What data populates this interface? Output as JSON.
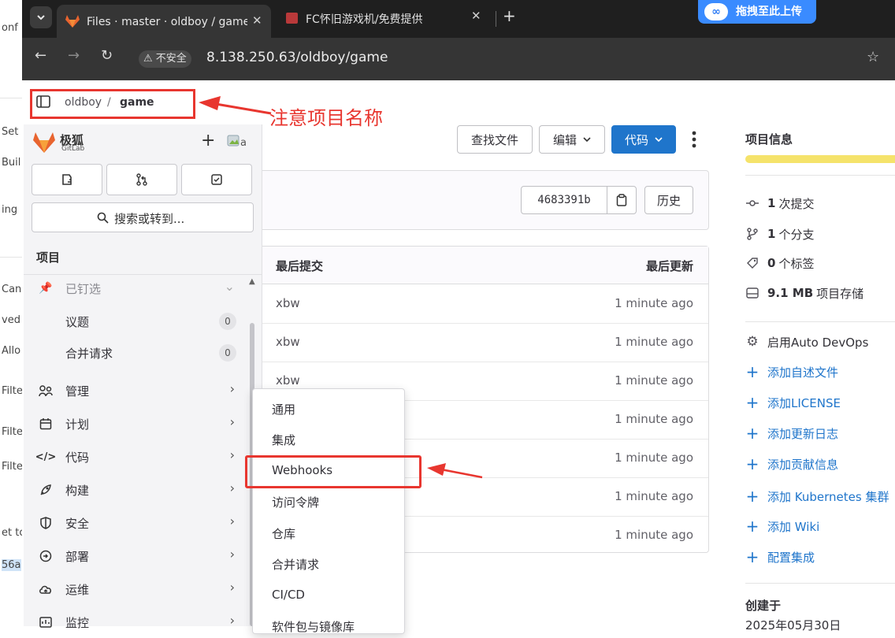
{
  "background_window": {
    "lines": [
      "onf",
      "Set",
      "Buil",
      "ing",
      "Can",
      "ved",
      "Allo",
      "Filte",
      "Filte",
      "Filte",
      "et to",
      "56a"
    ]
  },
  "browser": {
    "tabs": [
      {
        "title": "Files · master · oldboy / game",
        "active": true
      },
      {
        "title": "FC怀旧游戏机/免费提供",
        "active": false
      }
    ],
    "upload_badge": {
      "icon": "∞",
      "label": "拖拽至此上传"
    },
    "security_label": "不安全",
    "url": "8.138.250.63/oldboy/game"
  },
  "breadcrumb": {
    "owner": "oldboy",
    "project": "game"
  },
  "annotation": {
    "text": "注意项目名称"
  },
  "sidebar": {
    "brand_name": "极狐",
    "brand_sub": "GitLab",
    "search_label": "搜索或转到...",
    "section_title": "项目",
    "items": [
      {
        "label": "已钉选",
        "icon": "pin-icon",
        "muted": true
      },
      {
        "label": "议题",
        "badge": "0"
      },
      {
        "label": "合并请求",
        "badge": "0"
      },
      {
        "label": "管理",
        "icon": "people-icon"
      },
      {
        "label": "计划",
        "icon": "calendar-icon"
      },
      {
        "label": "代码",
        "icon": "code-icon"
      },
      {
        "label": "构建",
        "icon": "rocket-icon"
      },
      {
        "label": "安全",
        "icon": "shield-icon"
      },
      {
        "label": "部署",
        "icon": "deploy-icon"
      },
      {
        "label": "运维",
        "icon": "cloud-icon"
      },
      {
        "label": "监控",
        "icon": "monitor-icon"
      }
    ]
  },
  "flyout": {
    "items": [
      "通用",
      "集成",
      "Webhooks",
      "访问令牌",
      "仓库",
      "合并请求",
      "CI/CD",
      "软件包与镜像库"
    ]
  },
  "toolbar": {
    "find_file": "查找文件",
    "edit": "编辑",
    "code": "代码"
  },
  "commit": {
    "sha": "4683391b",
    "history": "历史"
  },
  "file_table": {
    "columns": [
      "最后提交",
      "最后更新"
    ],
    "rows": [
      {
        "name": "xbw",
        "time": "1 minute ago"
      },
      {
        "name": "xbw",
        "time": "1 minute ago"
      },
      {
        "name": "xbw",
        "time": "1 minute ago"
      },
      {
        "name": "",
        "time": "1 minute ago"
      },
      {
        "name": "",
        "time": "1 minute ago"
      },
      {
        "name": "",
        "time": "1 minute ago"
      },
      {
        "name": "",
        "time": "1 minute ago"
      }
    ]
  },
  "project_info": {
    "title": "项目信息",
    "stats": [
      {
        "value": "1",
        "label": "次提交",
        "icon": "commit-icon"
      },
      {
        "value": "1",
        "label": "个分支",
        "icon": "branch-icon"
      },
      {
        "value": "0",
        "label": "个标签",
        "icon": "tag-icon"
      },
      {
        "value": "9.1 MB",
        "label": "项目存储",
        "icon": "storage-icon"
      }
    ],
    "auto_devops": "启用Auto DevOps",
    "actions": [
      "添加自述文件",
      "添加LICENSE",
      "添加更新日志",
      "添加贡献信息",
      "添加 Kubernetes 集群",
      "添加 Wiki",
      "配置集成"
    ],
    "created_label": "创建于",
    "created_date": "2025年05月30日"
  },
  "colors": {
    "annotation_red": "#e8362f",
    "primary_blue": "#1f75cb",
    "code_button": "#1f75cb",
    "progress_yellow": "#f5e36b"
  }
}
